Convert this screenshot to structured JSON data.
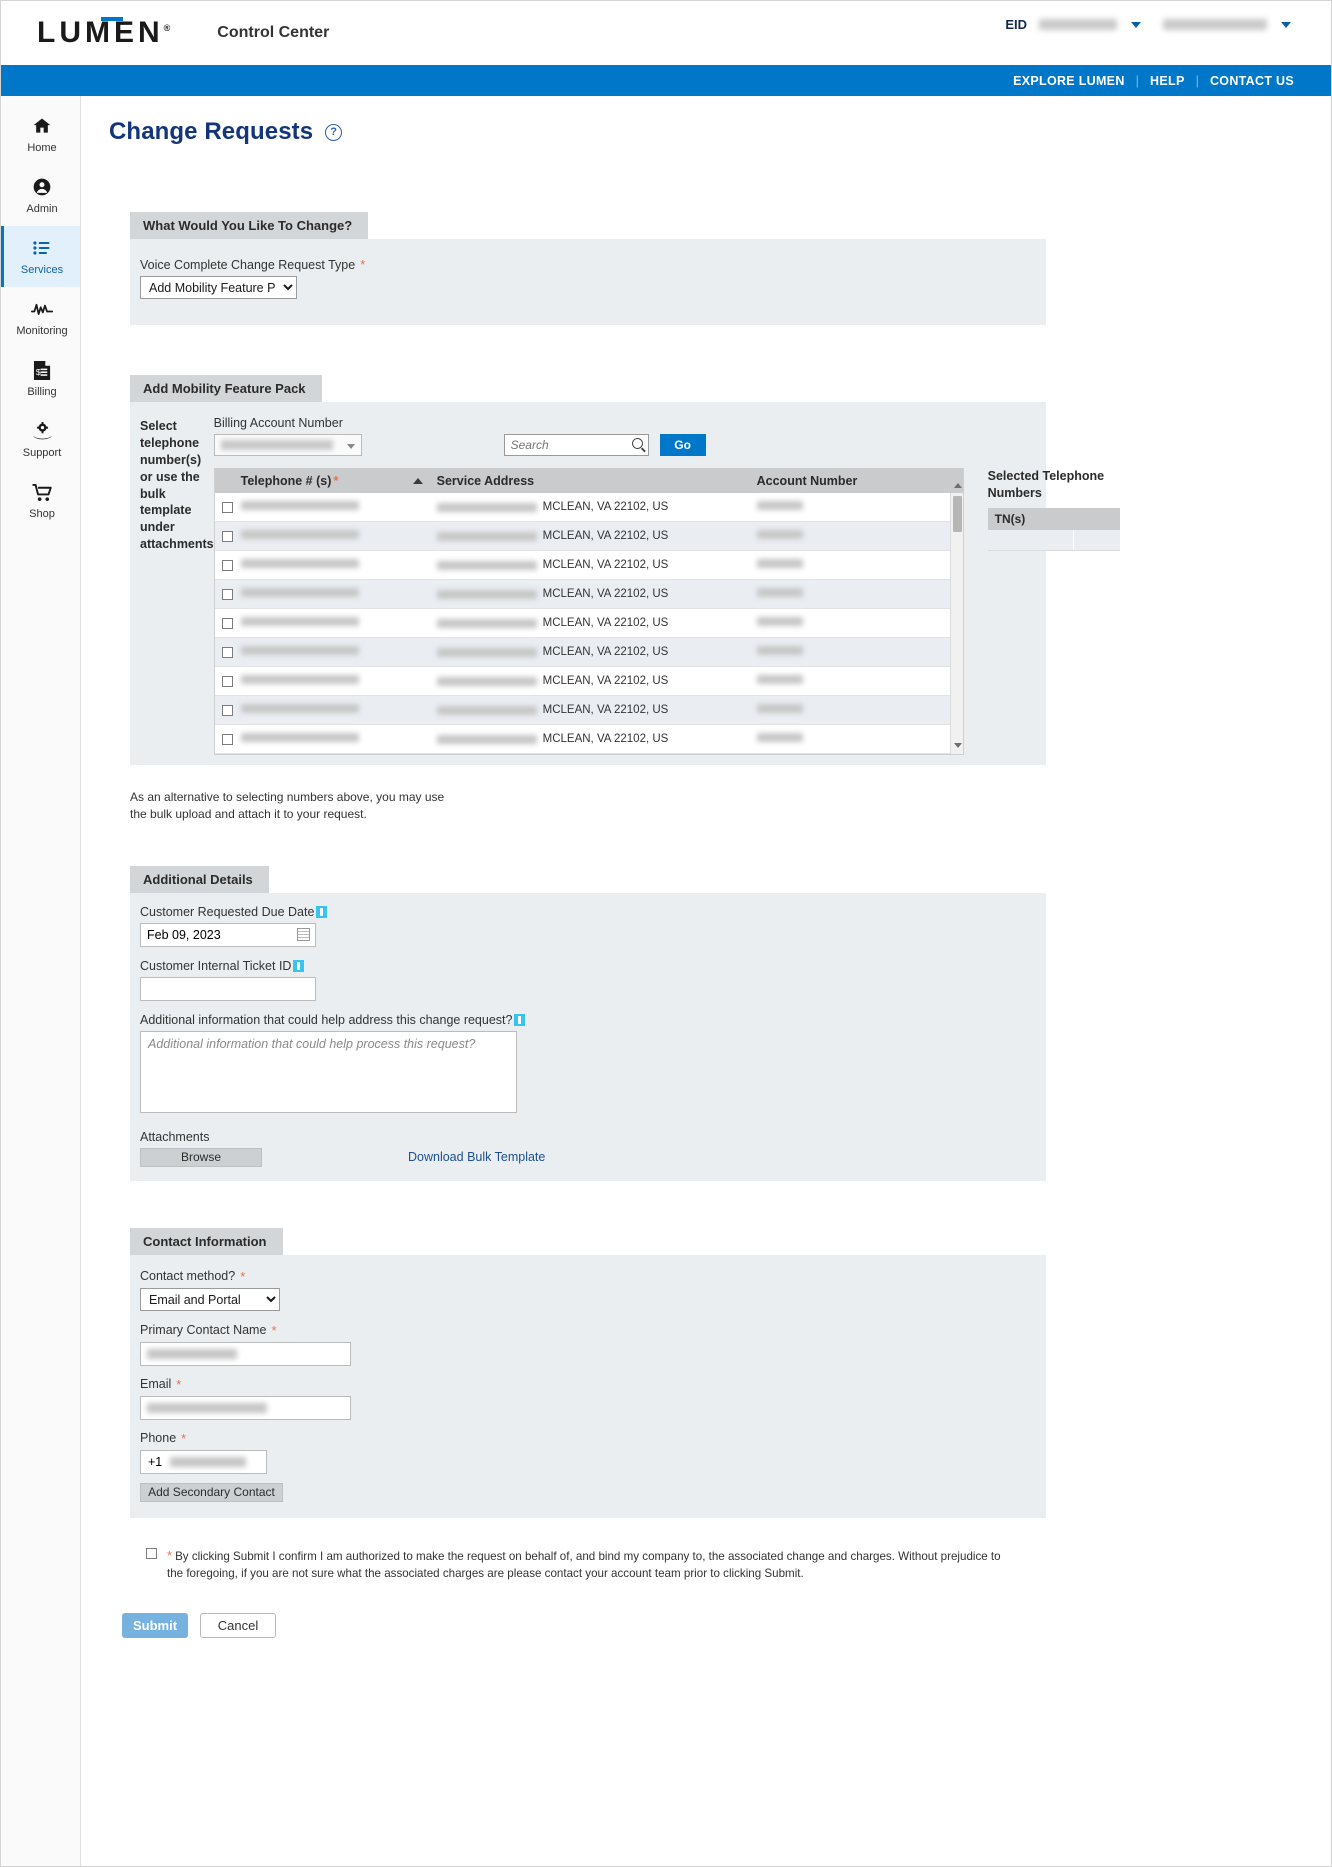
{
  "header": {
    "logo_text": "LUMEN",
    "app_title": "Control Center",
    "eid_label": "EID",
    "eid_value": "",
    "account_value": ""
  },
  "bluebar": {
    "explore": "EXPLORE LUMEN",
    "help": "HELP",
    "contact": "CONTACT US"
  },
  "sidebar": {
    "items": [
      {
        "label": "Home",
        "icon": "home-icon"
      },
      {
        "label": "Admin",
        "icon": "user-circle-icon"
      },
      {
        "label": "Services",
        "icon": "list-icon"
      },
      {
        "label": "Monitoring",
        "icon": "pulse-icon"
      },
      {
        "label": "Billing",
        "icon": "invoice-icon"
      },
      {
        "label": "Support",
        "icon": "gear-hand-icon"
      },
      {
        "label": "Shop",
        "icon": "cart-icon"
      }
    ],
    "active_index": 2
  },
  "page": {
    "title": "Change Requests"
  },
  "what_to_change": {
    "section_title": "What Would You Like To Change?",
    "field_label": "Voice Complete Change Request Type",
    "required": "*",
    "selected": "Add Mobility Feature Pack",
    "options": [
      "Add Mobility Feature Pack"
    ]
  },
  "mobility": {
    "section_title": "Add Mobility Feature Pack",
    "select_instructions": "Select telephone number(s) or use the bulk template under attachments",
    "ban_label": "Billing Account Number",
    "ban_value": "",
    "search_placeholder": "Search",
    "search_value": "",
    "go_label": "Go",
    "columns": [
      "Telephone # (s)",
      "Service Address",
      "Account Number"
    ],
    "sort_column": "Telephone # (s)",
    "sort_direction": "ascending",
    "rows": [
      {
        "telephone": "",
        "address": "MCLEAN, VA 22102, US",
        "account": ""
      },
      {
        "telephone": "",
        "address": "MCLEAN, VA 22102, US",
        "account": ""
      },
      {
        "telephone": "",
        "address": "MCLEAN, VA 22102, US",
        "account": ""
      },
      {
        "telephone": "",
        "address": "MCLEAN, VA 22102, US",
        "account": ""
      },
      {
        "telephone": "",
        "address": "MCLEAN, VA 22102, US",
        "account": ""
      },
      {
        "telephone": "",
        "address": "MCLEAN, VA 22102, US",
        "account": ""
      },
      {
        "telephone": "",
        "address": "MCLEAN, VA 22102, US",
        "account": ""
      },
      {
        "telephone": "",
        "address": "MCLEAN, VA 22102, US",
        "account": ""
      },
      {
        "telephone": "",
        "address": "MCLEAN, VA 22102, US",
        "account": ""
      }
    ],
    "selected_panel_title": "Selected Telephone Numbers",
    "selected_panel_column": "TN(s)"
  },
  "alt_note": "As an alternative to selecting numbers above, you may use the bulk upload and attach it to your request.",
  "additional_details": {
    "section_title": "Additional Details",
    "due_date_label": "Customer Requested Due Date",
    "due_date_value": "Feb 09, 2023",
    "ticket_label": "Customer Internal Ticket ID",
    "ticket_value": "",
    "info_label": "Additional information that could help address this change request?",
    "info_placeholder": "Additional information that could help process this request?",
    "info_value": "",
    "attachments_label": "Attachments",
    "browse_label": "Browse",
    "download_link": "Download Bulk Template"
  },
  "contact": {
    "section_title": "Contact Information",
    "method_label": "Contact method?",
    "method_value": "Email and Portal",
    "method_options": [
      "Email and Portal"
    ],
    "name_label": "Primary Contact Name",
    "name_value": "",
    "email_label": "Email",
    "email_value": "",
    "phone_label": "Phone",
    "phone_prefix": "+1",
    "phone_value": "",
    "add_secondary_label": "Add Secondary Contact"
  },
  "consent": {
    "required": "*",
    "text": "By clicking Submit I confirm I am authorized to make the request on behalf of, and bind my company to, the associated change and charges. Without prejudice to the foregoing, if you are not sure what the associated charges are please contact your account team prior to clicking Submit.",
    "checked": false
  },
  "actions": {
    "submit_label": "Submit",
    "cancel_label": "Cancel"
  },
  "colors": {
    "brand_blue": "#0077c8",
    "title_navy": "#13357b",
    "section_header_gray": "#d3d6d8",
    "section_body_gray": "#eaeef1",
    "required_orange": "#e8724c",
    "info_cyan": "#36c5f0",
    "submit_blue": "#76b2e0",
    "link_blue": "#1d4f91"
  }
}
